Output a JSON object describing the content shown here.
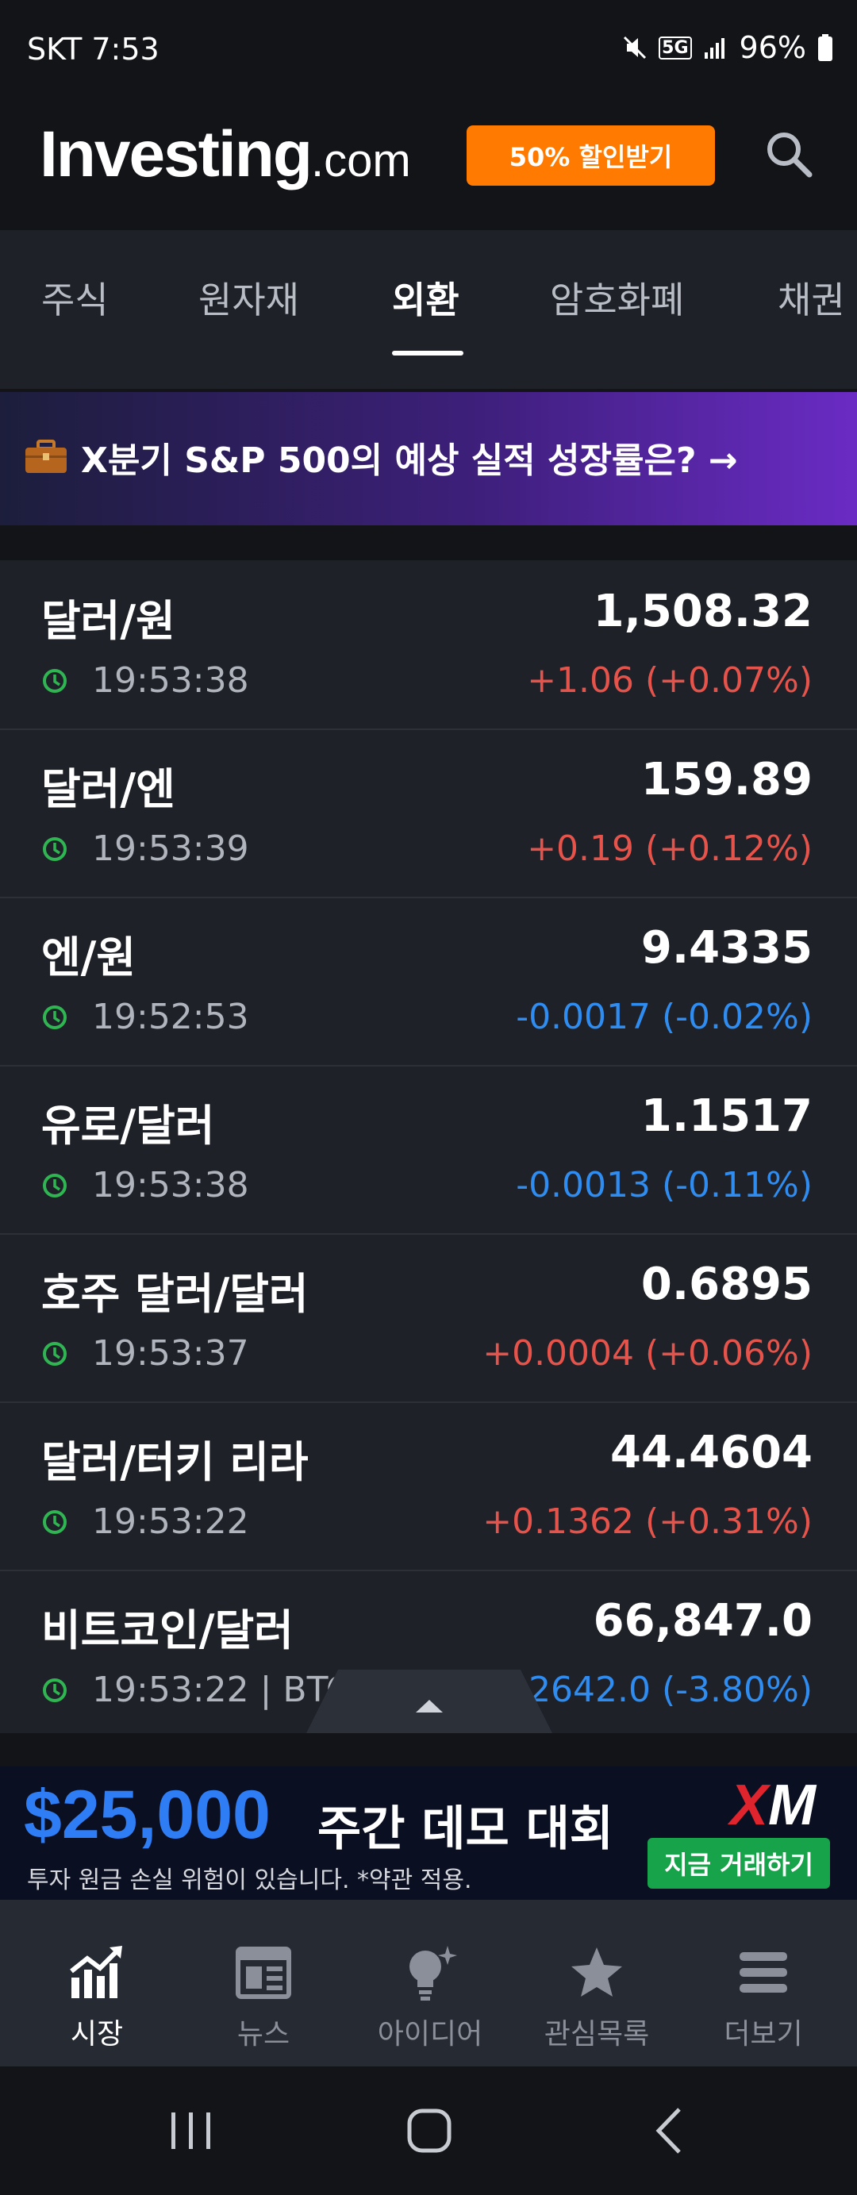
{
  "status_bar": {
    "carrier_time": "SKT 7:53",
    "network": "5G",
    "battery": "96%"
  },
  "header": {
    "logo_main": "Investing",
    "logo_suffix": ".com",
    "promo_button": "50% 할인받기"
  },
  "tabs": [
    {
      "label": "주식",
      "active": false
    },
    {
      "label": "원자재",
      "active": false
    },
    {
      "label": "외환",
      "active": true
    },
    {
      "label": "암호화폐",
      "active": false
    },
    {
      "label": "채권",
      "active": false
    }
  ],
  "banner": {
    "text": "X분기 S&P 500의 예상 실적 성장률은? →"
  },
  "quotes": [
    {
      "name": "달러/원",
      "price": "1,508.32",
      "time": "19:53:38",
      "change": "+1.06 (+0.07%)",
      "direction": "up"
    },
    {
      "name": "달러/엔",
      "price": "159.89",
      "time": "19:53:39",
      "change": "+0.19 (+0.12%)",
      "direction": "up"
    },
    {
      "name": "엔/원",
      "price": "9.4335",
      "time": "19:52:53",
      "change": "-0.0017 (-0.02%)",
      "direction": "down"
    },
    {
      "name": "유로/달러",
      "price": "1.1517",
      "time": "19:53:38",
      "change": "-0.0013 (-0.11%)",
      "direction": "down"
    },
    {
      "name": "호주 달러/달러",
      "price": "0.6895",
      "time": "19:53:37",
      "change": "+0.0004 (+0.06%)",
      "direction": "up"
    },
    {
      "name": "달러/터키 리라",
      "price": "44.4604",
      "time": "19:53:22",
      "change": "+0.1362 (+0.31%)",
      "direction": "up"
    },
    {
      "name": "비트코인/달러",
      "price": "66,847.0",
      "time": "19:53:22 | BTC",
      "change": "-2642.0 (-3.80%)",
      "direction": "down"
    }
  ],
  "ad": {
    "amount": "$25,000",
    "title": "주간 데모 대회",
    "disclaimer": "투자 원금 손실 위험이 있습니다. *약관 적용.",
    "brand": "XM",
    "cta": "지금 거래하기"
  },
  "bottom_nav": [
    {
      "label": "시장",
      "icon": "chart-icon",
      "active": true
    },
    {
      "label": "뉴스",
      "icon": "news-icon",
      "active": false
    },
    {
      "label": "아이디어",
      "icon": "lightbulb-icon",
      "active": false
    },
    {
      "label": "관심목록",
      "icon": "star-icon",
      "active": false
    },
    {
      "label": "더보기",
      "icon": "menu-icon",
      "active": false
    }
  ],
  "colors": {
    "up": "#e5534b",
    "down": "#2f8cf0",
    "accent": "#ff7a00",
    "cta": "#16a34a"
  }
}
